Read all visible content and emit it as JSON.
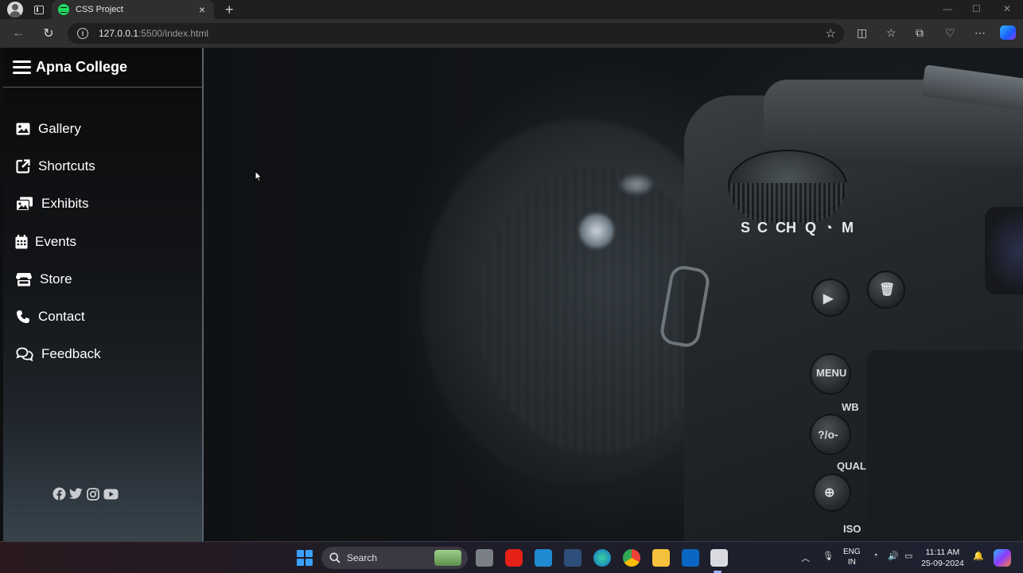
{
  "browser": {
    "tab_title": "CSS Project",
    "tab_close": "×",
    "new_tab": "+",
    "url_host": "127.0.0.1",
    "url_path": ":5500/index.html"
  },
  "sidebar": {
    "brand": "Apna College",
    "items": [
      {
        "label": "Gallery",
        "icon": "image-icon"
      },
      {
        "label": "Shortcuts",
        "icon": "external-link-icon"
      },
      {
        "label": "Exhibits",
        "icon": "photos-icon"
      },
      {
        "label": "Events",
        "icon": "calendar-icon"
      },
      {
        "label": "Store",
        "icon": "store-icon"
      },
      {
        "label": "Contact",
        "icon": "phone-icon"
      },
      {
        "label": "Feedback",
        "icon": "comments-icon"
      }
    ],
    "socials": [
      "facebook-icon",
      "twitter-icon",
      "instagram-icon",
      "youtube-icon"
    ]
  },
  "taskbar": {
    "search_label": "Search",
    "lang_top": "ENG",
    "lang_bottom": "IN",
    "time": "11:11 AM",
    "date": "25-09-2024"
  }
}
